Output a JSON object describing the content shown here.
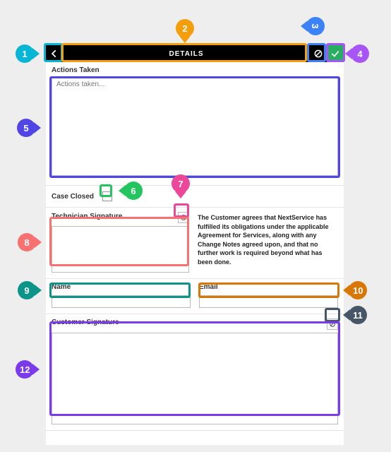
{
  "header": {
    "title": "DETAILS"
  },
  "sections": {
    "actions_label": "Actions Taken",
    "actions_placeholder": "Actions taken...",
    "closed_label": "Case Closed",
    "tech_sig_label": "Technician Signature",
    "agreement": "The Customer agrees that NextService has fulfilled its obligations under the applicable Agreement for Services, along with any Change Notes agreed upon, and that no further work is required beyond what has been done.",
    "name_label": "Name",
    "email_label": "Email",
    "cust_sig_label": "Customer Signature"
  },
  "annotations": {
    "n1": "1",
    "n2": "2",
    "n3": "3",
    "n4": "4",
    "n5": "5",
    "n6": "6",
    "n7": "7",
    "n8": "8",
    "n9": "9",
    "n10": "10",
    "n11": "11",
    "n12": "12"
  },
  "colors": {
    "c1": "#06b6d4",
    "c2": "#f59e0b",
    "c3": "#3b82f6",
    "c4": "#a855f7",
    "c5": "#4f46e5",
    "c6": "#22c55e",
    "c7": "#ec4899",
    "c8": "#f87171",
    "c9": "#0d9488",
    "c10": "#d97706",
    "c11": "#475569",
    "c12": "#7c3aed"
  }
}
